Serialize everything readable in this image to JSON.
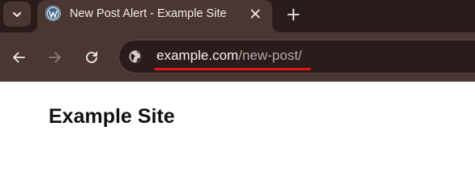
{
  "tab": {
    "title": "New Post Alert - Example Site",
    "favicon": "wordpress-icon"
  },
  "address_bar": {
    "host": "example.com",
    "path": "/new-post/"
  },
  "page": {
    "site_title": "Example Site"
  },
  "colors": {
    "tab_strip": "#2a1c1a",
    "toolbar": "#4a3632",
    "url_underline": "#e0141b"
  }
}
